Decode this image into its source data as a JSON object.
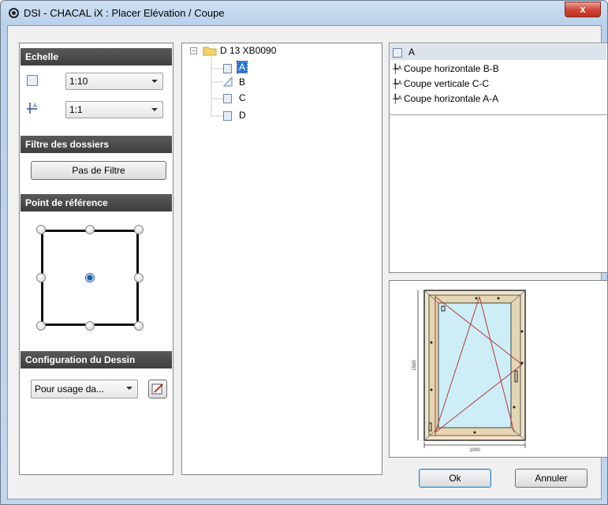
{
  "window": {
    "title": "DSI - CHACAL iX : Placer Elévation / Coupe",
    "close_label": "x"
  },
  "left": {
    "echelle": {
      "header": "Echelle",
      "scale1": "1:10",
      "scale2": "1:1"
    },
    "filtre": {
      "header": "Filtre des dossiers",
      "button": "Pas de Filtre"
    },
    "point": {
      "header": "Point de référence",
      "selected": "center"
    },
    "config": {
      "header": "Configuration du Dessin",
      "dropdown": "Pour usage da..."
    }
  },
  "tree": {
    "root": "D 13 XB0090",
    "children": [
      {
        "label": "A",
        "icon": "square-icon",
        "selected": true
      },
      {
        "label": "B",
        "icon": "triangle-icon",
        "selected": false
      },
      {
        "label": "C",
        "icon": "square-icon",
        "selected": false
      },
      {
        "label": "D",
        "icon": "square-icon",
        "selected": false
      }
    ]
  },
  "views_list": {
    "items": [
      {
        "label": "A",
        "icon": "square-icon",
        "selected": true
      },
      {
        "label": "Coupe horizontale B-B",
        "icon": "section-cut-icon"
      },
      {
        "label": "Coupe verticale C-C",
        "icon": "section-cut-icon"
      },
      {
        "label": "Coupe horizontale A-A",
        "icon": "section-cut-icon"
      }
    ]
  },
  "preview": {
    "width_dim": "1000",
    "height_dim": "1500"
  },
  "footer": {
    "ok": "Ok",
    "cancel": "Annuler"
  },
  "colors": {
    "header_bg": "#4a4a4a",
    "frame": "#e8dcc0",
    "glass": "#cdeef7",
    "red_lines": "#b33a3a"
  }
}
